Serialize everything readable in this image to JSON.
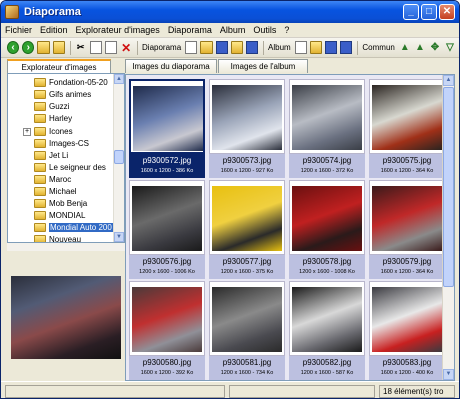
{
  "window": {
    "title": "Diaporama",
    "controls": {
      "minimize": "_",
      "maximize": "□",
      "close": "✕"
    }
  },
  "menu": [
    "Fichier",
    "Edition",
    "Explorateur d'images",
    "Diaporama",
    "Album",
    "Outils",
    "?"
  ],
  "toolbar": {
    "diaporama_label": "Diaporama",
    "album_label": "Album",
    "commun_label": "Commun"
  },
  "left_tabs": {
    "explorer": "Explorateur d'images"
  },
  "right_tabs": {
    "slideshow": "Images du diaporama",
    "album": "Images de l'album"
  },
  "tree": {
    "items": [
      {
        "label": "Fondation-05-20"
      },
      {
        "label": "Gifs animes"
      },
      {
        "label": "Guzzi"
      },
      {
        "label": "Harley"
      },
      {
        "label": "Icones",
        "expandable": "+"
      },
      {
        "label": "Images-CS"
      },
      {
        "label": "Jet Li"
      },
      {
        "label": "Le seigneur des"
      },
      {
        "label": "Maroc"
      },
      {
        "label": "Michael"
      },
      {
        "label": "Mob Benja"
      },
      {
        "label": "MONDIAL"
      },
      {
        "label": "Mondial Auto 200",
        "selected": true
      },
      {
        "label": "Nouveau"
      }
    ]
  },
  "thumbnails": [
    {
      "name": "p9300572.jpg",
      "info": "1600 x 1200 - 386 Ko",
      "selected": true,
      "colors": [
        "#1e2a4a",
        "#6a7fb0",
        "#c8c8d0"
      ]
    },
    {
      "name": "p9300573.jpg",
      "info": "1600 x 1200 - 927 Ko",
      "colors": [
        "#2a2e3a",
        "#9aa4b8",
        "#e0e4ec"
      ]
    },
    {
      "name": "p9300574.jpg",
      "info": "1200 x 1600 - 372 Ko",
      "colors": [
        "#3a3e46",
        "#b8bcc4",
        "#6a7080"
      ]
    },
    {
      "name": "p9300575.jpg",
      "info": "1600 x 1200 - 364 Ko",
      "colors": [
        "#2a2420",
        "#d8d8d0",
        "#a03018"
      ]
    },
    {
      "name": "p9300576.jpg",
      "info": "1200 x 1600 - 1006 Ko",
      "colors": [
        "#1a1a1a",
        "#6a6a6a",
        "#3a3a40"
      ]
    },
    {
      "name": "p9300577.jpg",
      "info": "1200 x 1600 - 375 Ko",
      "colors": [
        "#e8c010",
        "#f0d040",
        "#2a2a2a"
      ]
    },
    {
      "name": "p9300578.jpg",
      "info": "1200 x 1600 - 1008 Ko",
      "colors": [
        "#6a1010",
        "#c02020",
        "#2a1a1a"
      ]
    },
    {
      "name": "p9300579.jpg",
      "info": "1600 x 1200 - 364 Ko",
      "colors": [
        "#3a1a1a",
        "#c02828",
        "#8a8a8a"
      ]
    },
    {
      "name": "p9300580.jpg",
      "info": "1600 x 1200 - 392 Ko",
      "colors": [
        "#4a3a3a",
        "#c03030",
        "#909098"
      ]
    },
    {
      "name": "p9300581.jpg",
      "info": "1200 x 1600 - 734 Ko",
      "colors": [
        "#2a2a2a",
        "#8a8a8a",
        "#4a4a50"
      ]
    },
    {
      "name": "p9300582.jpg",
      "info": "1200 x 1600 - 587 Ko",
      "colors": [
        "#1a1a1a",
        "#d8d8d8",
        "#6a6a70"
      ]
    },
    {
      "name": "p9300583.jpg",
      "info": "1600 x 1200 - 400 Ko",
      "colors": [
        "#3a3a40",
        "#e8e8e8",
        "#c82020"
      ]
    }
  ],
  "status": {
    "message": "",
    "count": "18 élément(s) tro"
  }
}
